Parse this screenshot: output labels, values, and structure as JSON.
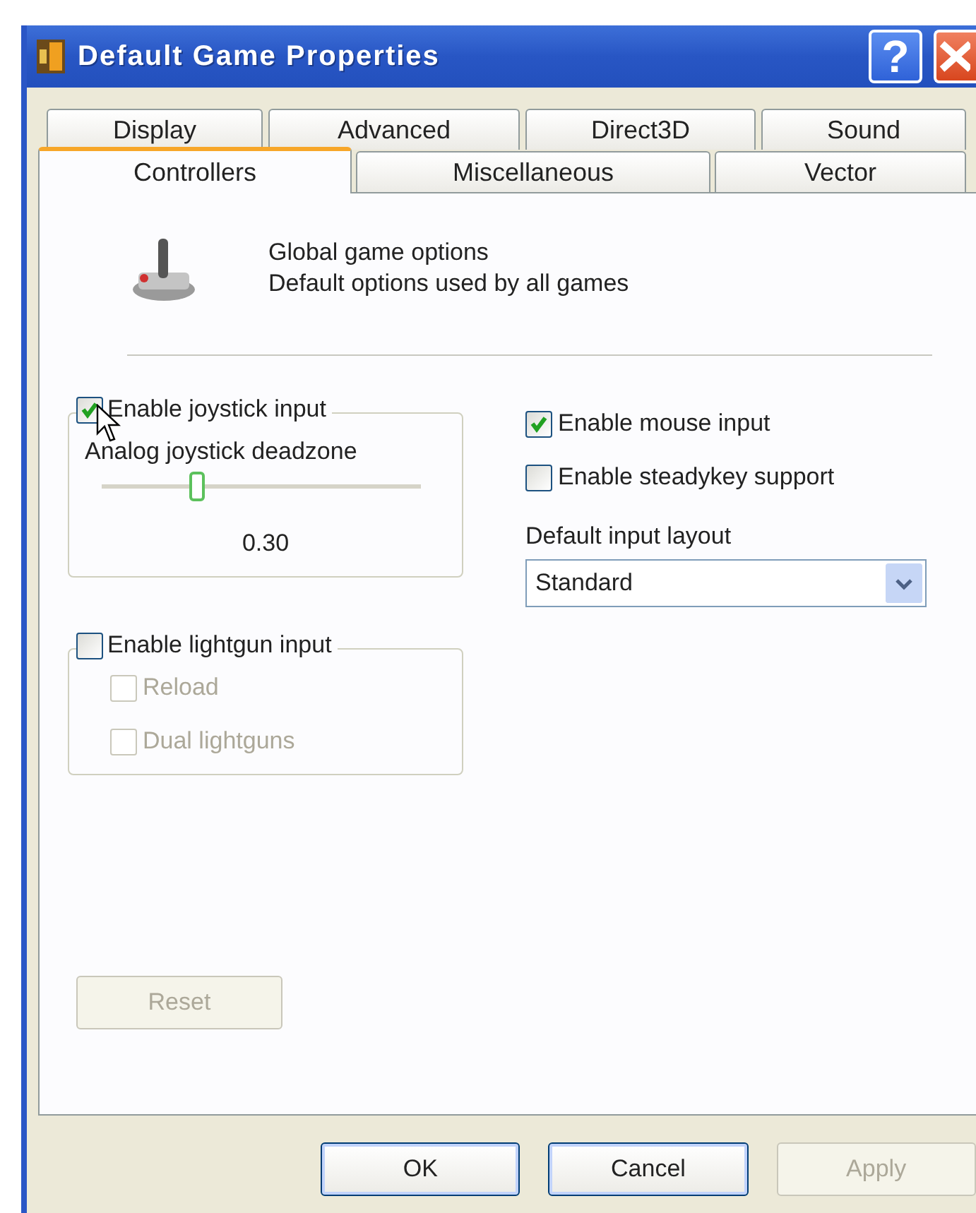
{
  "window": {
    "title": "Default Game Properties",
    "help_label": "?"
  },
  "tab_rows": [
    {
      "tabs": [
        {
          "label": "Display",
          "selected": false
        },
        {
          "label": "Advanced",
          "selected": false
        },
        {
          "label": "Direct3D",
          "selected": false
        },
        {
          "label": "Sound",
          "selected": false
        }
      ]
    },
    {
      "tabs": [
        {
          "label": "Controllers",
          "selected": true
        },
        {
          "label": "Miscellaneous",
          "selected": false
        },
        {
          "label": "Vector",
          "selected": false
        }
      ]
    }
  ],
  "header": {
    "title": "Global game options",
    "subtitle": "Default options used by all games"
  },
  "joystick_group": {
    "label": "Enable joystick input",
    "checked": true,
    "slider_label": "Analog joystick deadzone",
    "level": 0.3,
    "reading": "0.30"
  },
  "lightgun_group": {
    "label": "Enable lightgun input",
    "checked": false,
    "options": [
      {
        "label": "Reload",
        "checked": false,
        "disabled": true
      },
      {
        "label": "Dual lightguns",
        "checked": false,
        "disabled": true
      }
    ]
  },
  "right_options": [
    {
      "label": "Enable mouse input",
      "checked": true
    },
    {
      "label": "Enable steadykey support",
      "checked": false
    }
  ],
  "input_layout": {
    "label": "Default input layout",
    "value": "Standard"
  },
  "reset_button": {
    "label": "Reset",
    "disabled": true
  },
  "buttons": [
    {
      "label": "OK",
      "disabled": false
    },
    {
      "label": "Cancel",
      "disabled": false
    },
    {
      "label": "Apply",
      "disabled": true
    }
  ]
}
